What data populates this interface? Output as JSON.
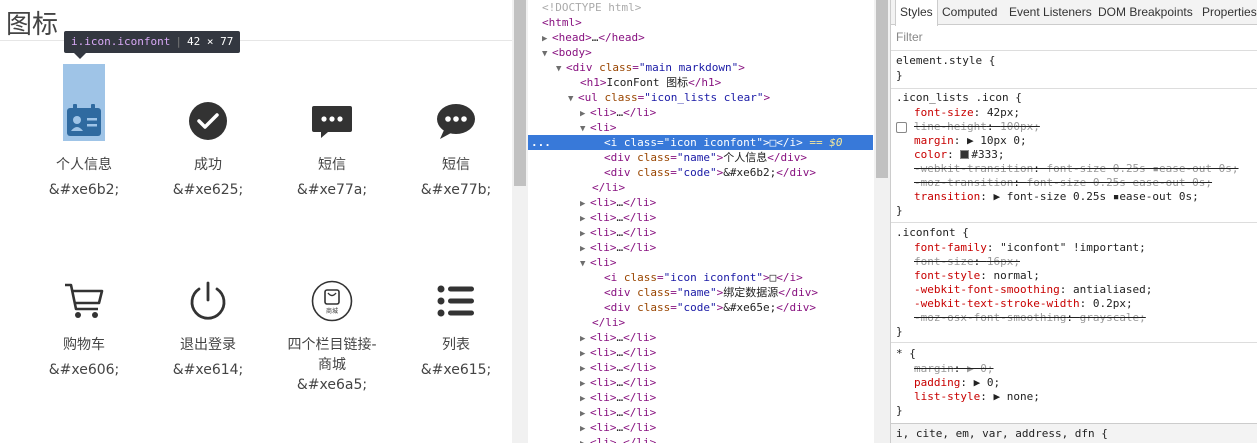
{
  "preview": {
    "title": "图标",
    "tooltip": {
      "selector": "i.icon.iconfont",
      "size": "42 × 77"
    },
    "icons": [
      {
        "name": "个人信息",
        "code": "&#xe6b2;",
        "icon": "id-card-icon"
      },
      {
        "name": "成功",
        "code": "&#xe625;",
        "icon": "check-circle-icon"
      },
      {
        "name": "短信",
        "code": "&#xe77a;",
        "icon": "message-square-icon"
      },
      {
        "name": "短信",
        "code": "&#xe77b;",
        "icon": "message-round-icon"
      },
      {
        "name": "购物车",
        "code": "&#xe606;",
        "icon": "shopping-cart-icon"
      },
      {
        "name": "退出登录",
        "code": "&#xe614;",
        "icon": "power-icon"
      },
      {
        "name": "四个栏目链接-商城",
        "code": "&#xe6a5;",
        "icon": "mall-bag-icon",
        "badge": "商城"
      },
      {
        "name": "列表",
        "code": "&#xe615;",
        "icon": "list-icon"
      }
    ]
  },
  "elements": {
    "doctype": "<!DOCTYPE html>",
    "lines": {
      "html": "html",
      "head": "head",
      "head_close": "/head",
      "body": "body",
      "div_tag": "div",
      "class_attr": "class",
      "main_val": "\"main markdown\"",
      "h1_text": "IconFont 图标",
      "h1": "h1",
      "h1_close": "/h1",
      "ul": "ul",
      "ul_val": "\"icon_lists clear\"",
      "li": "li",
      "li_close": "/li",
      "ellipsis": "…",
      "i_tag": "i",
      "icon_val": "\"icon iconfont\"",
      "glyph": "□",
      "i_close": "/i",
      "eq_marker": "== $0",
      "name_val": "\"name\"",
      "code_val": "\"code\"",
      "div_close": "/div",
      "name1": "个人信息",
      "code1": "&#xe6b2;",
      "name2": "绑定数据源",
      "code2": "&#xe65e;",
      "dots": "..."
    }
  },
  "styles": {
    "tabs": [
      "Styles",
      "Computed",
      "Event Listeners",
      "DOM Breakpoints",
      "Properties"
    ],
    "filter_placeholder": "Filter",
    "element_style": "element.style {",
    "rule1": {
      "selector": ".icon_lists .icon {",
      "props": [
        {
          "name": "font-size",
          "value": "42px;",
          "struck": false
        },
        {
          "name": "line-height",
          "value": "100px;",
          "struck": true
        },
        {
          "name": "margin",
          "value": "▶ 10px 0;",
          "struck": false
        },
        {
          "name": "color",
          "value": "#333;",
          "struck": false
        },
        {
          "name": "-webkit-transition",
          "value": "font-size 0.25s ▪ease-out 0s;",
          "struck": true
        },
        {
          "name": "-moz-transition",
          "value": "font-size 0.25s ease-out 0s;",
          "struck": true
        },
        {
          "name": "transition",
          "value": "▶ font-size 0.25s ▪ease-out 0s;",
          "struck": false
        }
      ]
    },
    "rule2": {
      "selector": ".iconfont {",
      "props": [
        {
          "name": "font-family",
          "value": "\"iconfont\" !important;",
          "struck": false
        },
        {
          "name": "font-size",
          "value": "16px;",
          "struck": true
        },
        {
          "name": "font-style",
          "value": "normal;",
          "struck": false
        },
        {
          "name": "-webkit-font-smoothing",
          "value": "antialiased;",
          "struck": false
        },
        {
          "name": "-webkit-text-stroke-width",
          "value": "0.2px;",
          "struck": false
        },
        {
          "name": "-moz-osx-font-smoothing",
          "value": "grayscale;",
          "struck": true
        }
      ]
    },
    "rule3": {
      "selector": "* {",
      "props": [
        {
          "name": "margin",
          "value": "▶ 0;",
          "struck": true
        },
        {
          "name": "padding",
          "value": "▶ 0;",
          "struck": false
        },
        {
          "name": "list-style",
          "value": "▶ none;",
          "struck": false
        }
      ]
    },
    "close_brace": "}",
    "bottom_selector": "i, cite, em, var, address, dfn {"
  }
}
